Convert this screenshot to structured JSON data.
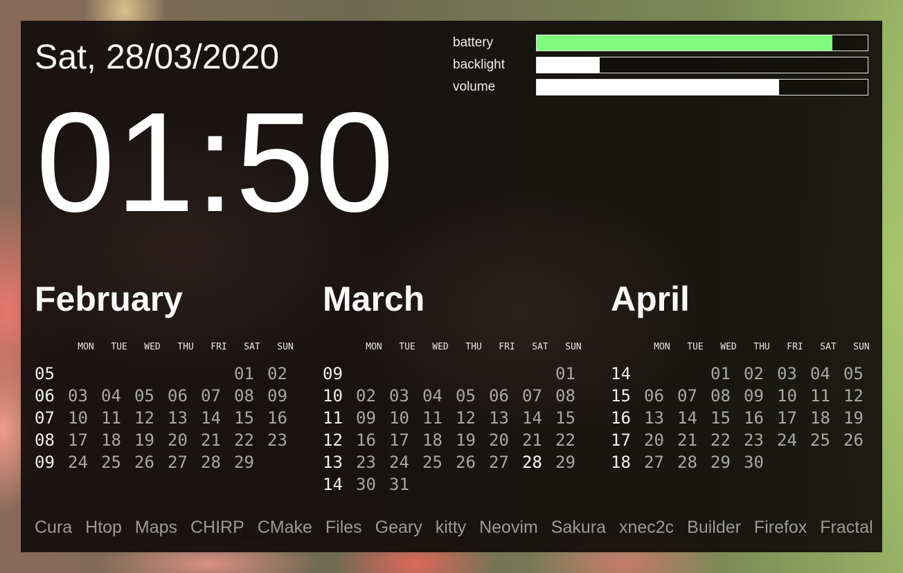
{
  "date": "Sat, 28/03/2020",
  "time": "01:50",
  "meters": [
    {
      "label": "battery",
      "level": 0.893,
      "color": "#80fb7e"
    },
    {
      "label": "backlight",
      "level": 0.19,
      "color": "#ffffff"
    },
    {
      "label": "volume",
      "level": 0.732,
      "color": "#ffffff"
    }
  ],
  "weekdays": [
    "MON",
    "TUE",
    "WED",
    "THU",
    "FRI",
    "SAT",
    "SUN"
  ],
  "months": [
    {
      "name": "February",
      "rows": [
        {
          "week": "05",
          "days": [
            "",
            "",
            "",
            "",
            "",
            "01",
            "02"
          ]
        },
        {
          "week": "06",
          "days": [
            "03",
            "04",
            "05",
            "06",
            "07",
            "08",
            "09"
          ]
        },
        {
          "week": "07",
          "days": [
            "10",
            "11",
            "12",
            "13",
            "14",
            "15",
            "16"
          ]
        },
        {
          "week": "08",
          "days": [
            "17",
            "18",
            "19",
            "20",
            "21",
            "22",
            "23"
          ]
        },
        {
          "week": "09",
          "days": [
            "24",
            "25",
            "26",
            "27",
            "28",
            "29",
            ""
          ]
        }
      ]
    },
    {
      "name": "March",
      "rows": [
        {
          "week": "09",
          "days": [
            "",
            "",
            "",
            "",
            "",
            "",
            "01"
          ]
        },
        {
          "week": "10",
          "days": [
            "02",
            "03",
            "04",
            "05",
            "06",
            "07",
            "08"
          ]
        },
        {
          "week": "11",
          "days": [
            "09",
            "10",
            "11",
            "12",
            "13",
            "14",
            "15"
          ]
        },
        {
          "week": "12",
          "days": [
            "16",
            "17",
            "18",
            "19",
            "20",
            "21",
            "22"
          ]
        },
        {
          "week": "13",
          "days": [
            "23",
            "24",
            "25",
            "26",
            "27",
            "28",
            "29"
          ]
        },
        {
          "week": "14",
          "days": [
            "30",
            "31",
            "",
            "",
            "",
            "",
            ""
          ]
        }
      ],
      "today": "28"
    },
    {
      "name": "April",
      "rows": [
        {
          "week": "14",
          "days": [
            "",
            "",
            "01",
            "02",
            "03",
            "04",
            "05"
          ]
        },
        {
          "week": "15",
          "days": [
            "06",
            "07",
            "08",
            "09",
            "10",
            "11",
            "12"
          ]
        },
        {
          "week": "16",
          "days": [
            "13",
            "14",
            "15",
            "16",
            "17",
            "18",
            "19"
          ]
        },
        {
          "week": "17",
          "days": [
            "20",
            "21",
            "22",
            "23",
            "24",
            "25",
            "26"
          ]
        },
        {
          "week": "18",
          "days": [
            "27",
            "28",
            "29",
            "30",
            "",
            "",
            ""
          ]
        }
      ]
    }
  ],
  "apps": [
    "Cura",
    "Htop",
    "Maps",
    "CHIRP",
    "CMake",
    "Files",
    "Geary",
    "kitty",
    "Neovim",
    "Sakura",
    "xnec2c",
    "Builder",
    "Firefox",
    "Fractal"
  ]
}
